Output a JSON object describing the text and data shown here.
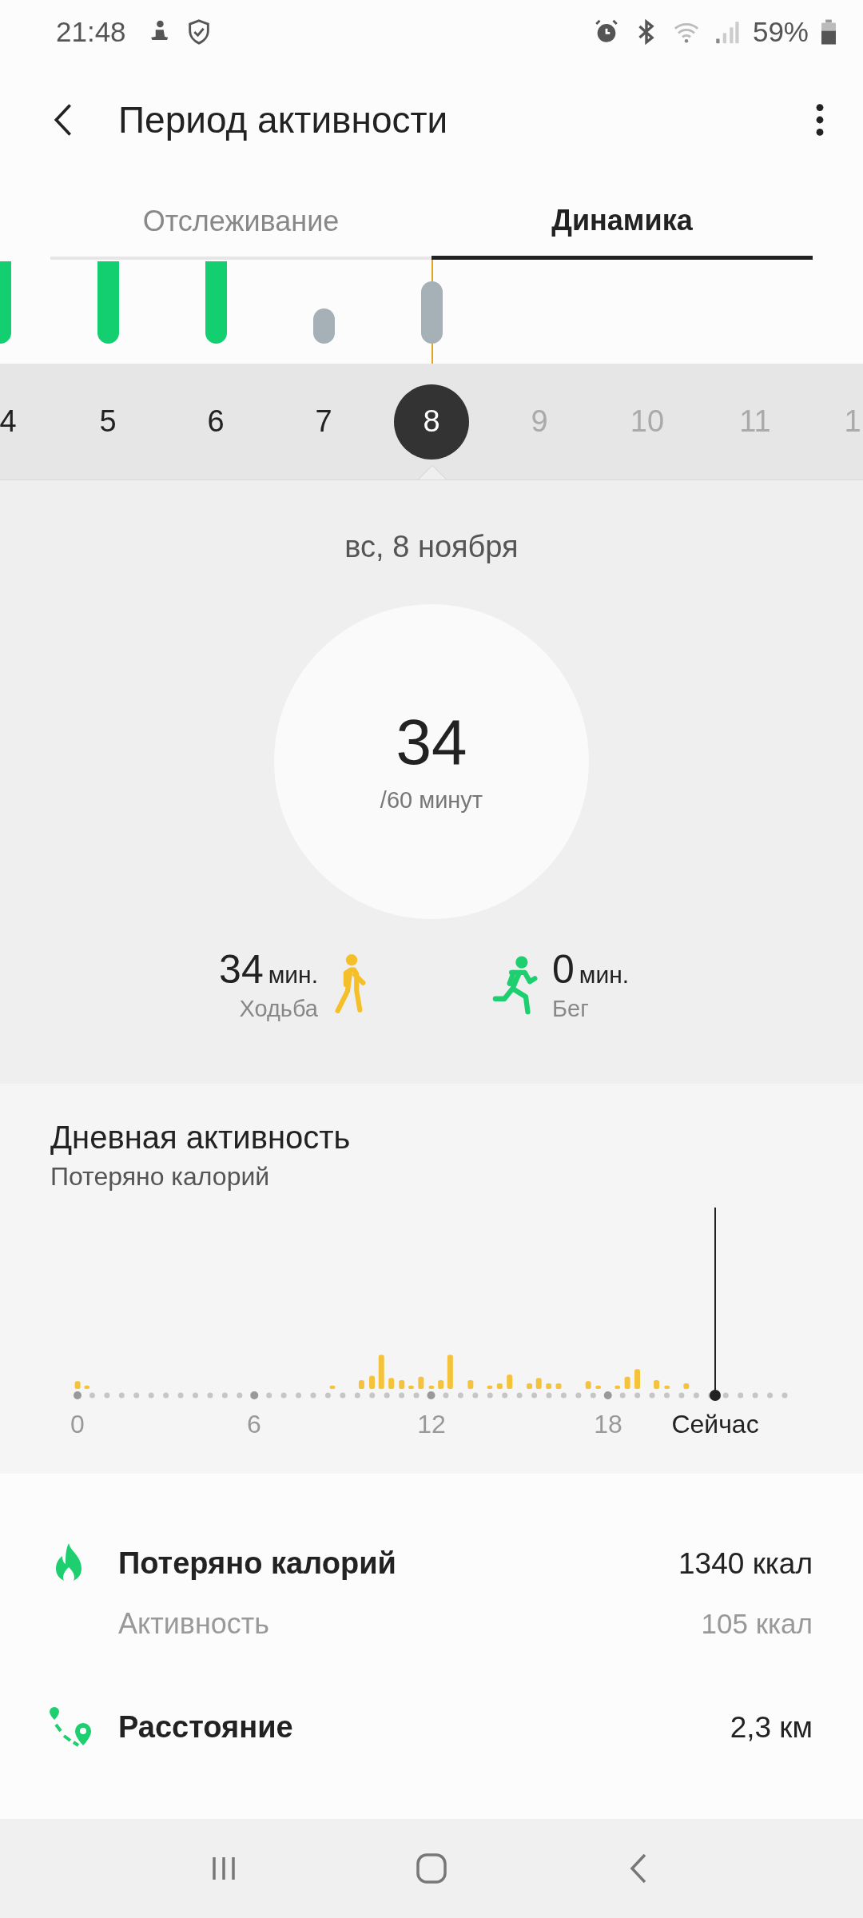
{
  "status_bar": {
    "time": "21:48",
    "battery": "59%"
  },
  "header": {
    "title": "Период активности"
  },
  "tabs": [
    {
      "label": "Отслеживание",
      "selected": false
    },
    {
      "label": "Динамика",
      "selected": true
    }
  ],
  "days": [
    {
      "label": "4",
      "selected": false,
      "disabled": false,
      "bar": {
        "goal_met": true
      }
    },
    {
      "label": "5",
      "selected": false,
      "disabled": false,
      "bar": {
        "goal_met": true
      }
    },
    {
      "label": "6",
      "selected": false,
      "disabled": false,
      "bar": {
        "goal_met": true
      }
    },
    {
      "label": "7",
      "selected": false,
      "disabled": false,
      "bar": {
        "goal_met": false
      }
    },
    {
      "label": "8",
      "selected": true,
      "disabled": false,
      "bar": {
        "goal_met": false
      }
    },
    {
      "label": "9",
      "selected": false,
      "disabled": true
    },
    {
      "label": "10",
      "selected": false,
      "disabled": true
    },
    {
      "label": "11",
      "selected": false,
      "disabled": true
    },
    {
      "label": "1",
      "selected": false,
      "disabled": true
    }
  ],
  "summary": {
    "date": "вс, 8 ноября",
    "minutes": "34",
    "goal": "/60 минут",
    "activities": [
      {
        "kind": "walk",
        "value": "34",
        "unit": "мин.",
        "label": "Ходьба"
      },
      {
        "kind": "run",
        "value": "0",
        "unit": "мин.",
        "label": "Бег"
      }
    ]
  },
  "daily_activity": {
    "title": "Дневная активность",
    "subtitle": "Потеряно калорий",
    "axis_labels": [
      "0",
      "6",
      "12",
      "18"
    ],
    "now_label": "Сейчас"
  },
  "stats": [
    {
      "kind": "calories",
      "label": "Потеряно калорий",
      "value": "1340 ккал"
    },
    {
      "kind": "sub",
      "label": "Активность",
      "value": "105 ккал"
    },
    {
      "kind": "distance",
      "label": "Расстояние",
      "value": "2,3 км"
    }
  ]
}
